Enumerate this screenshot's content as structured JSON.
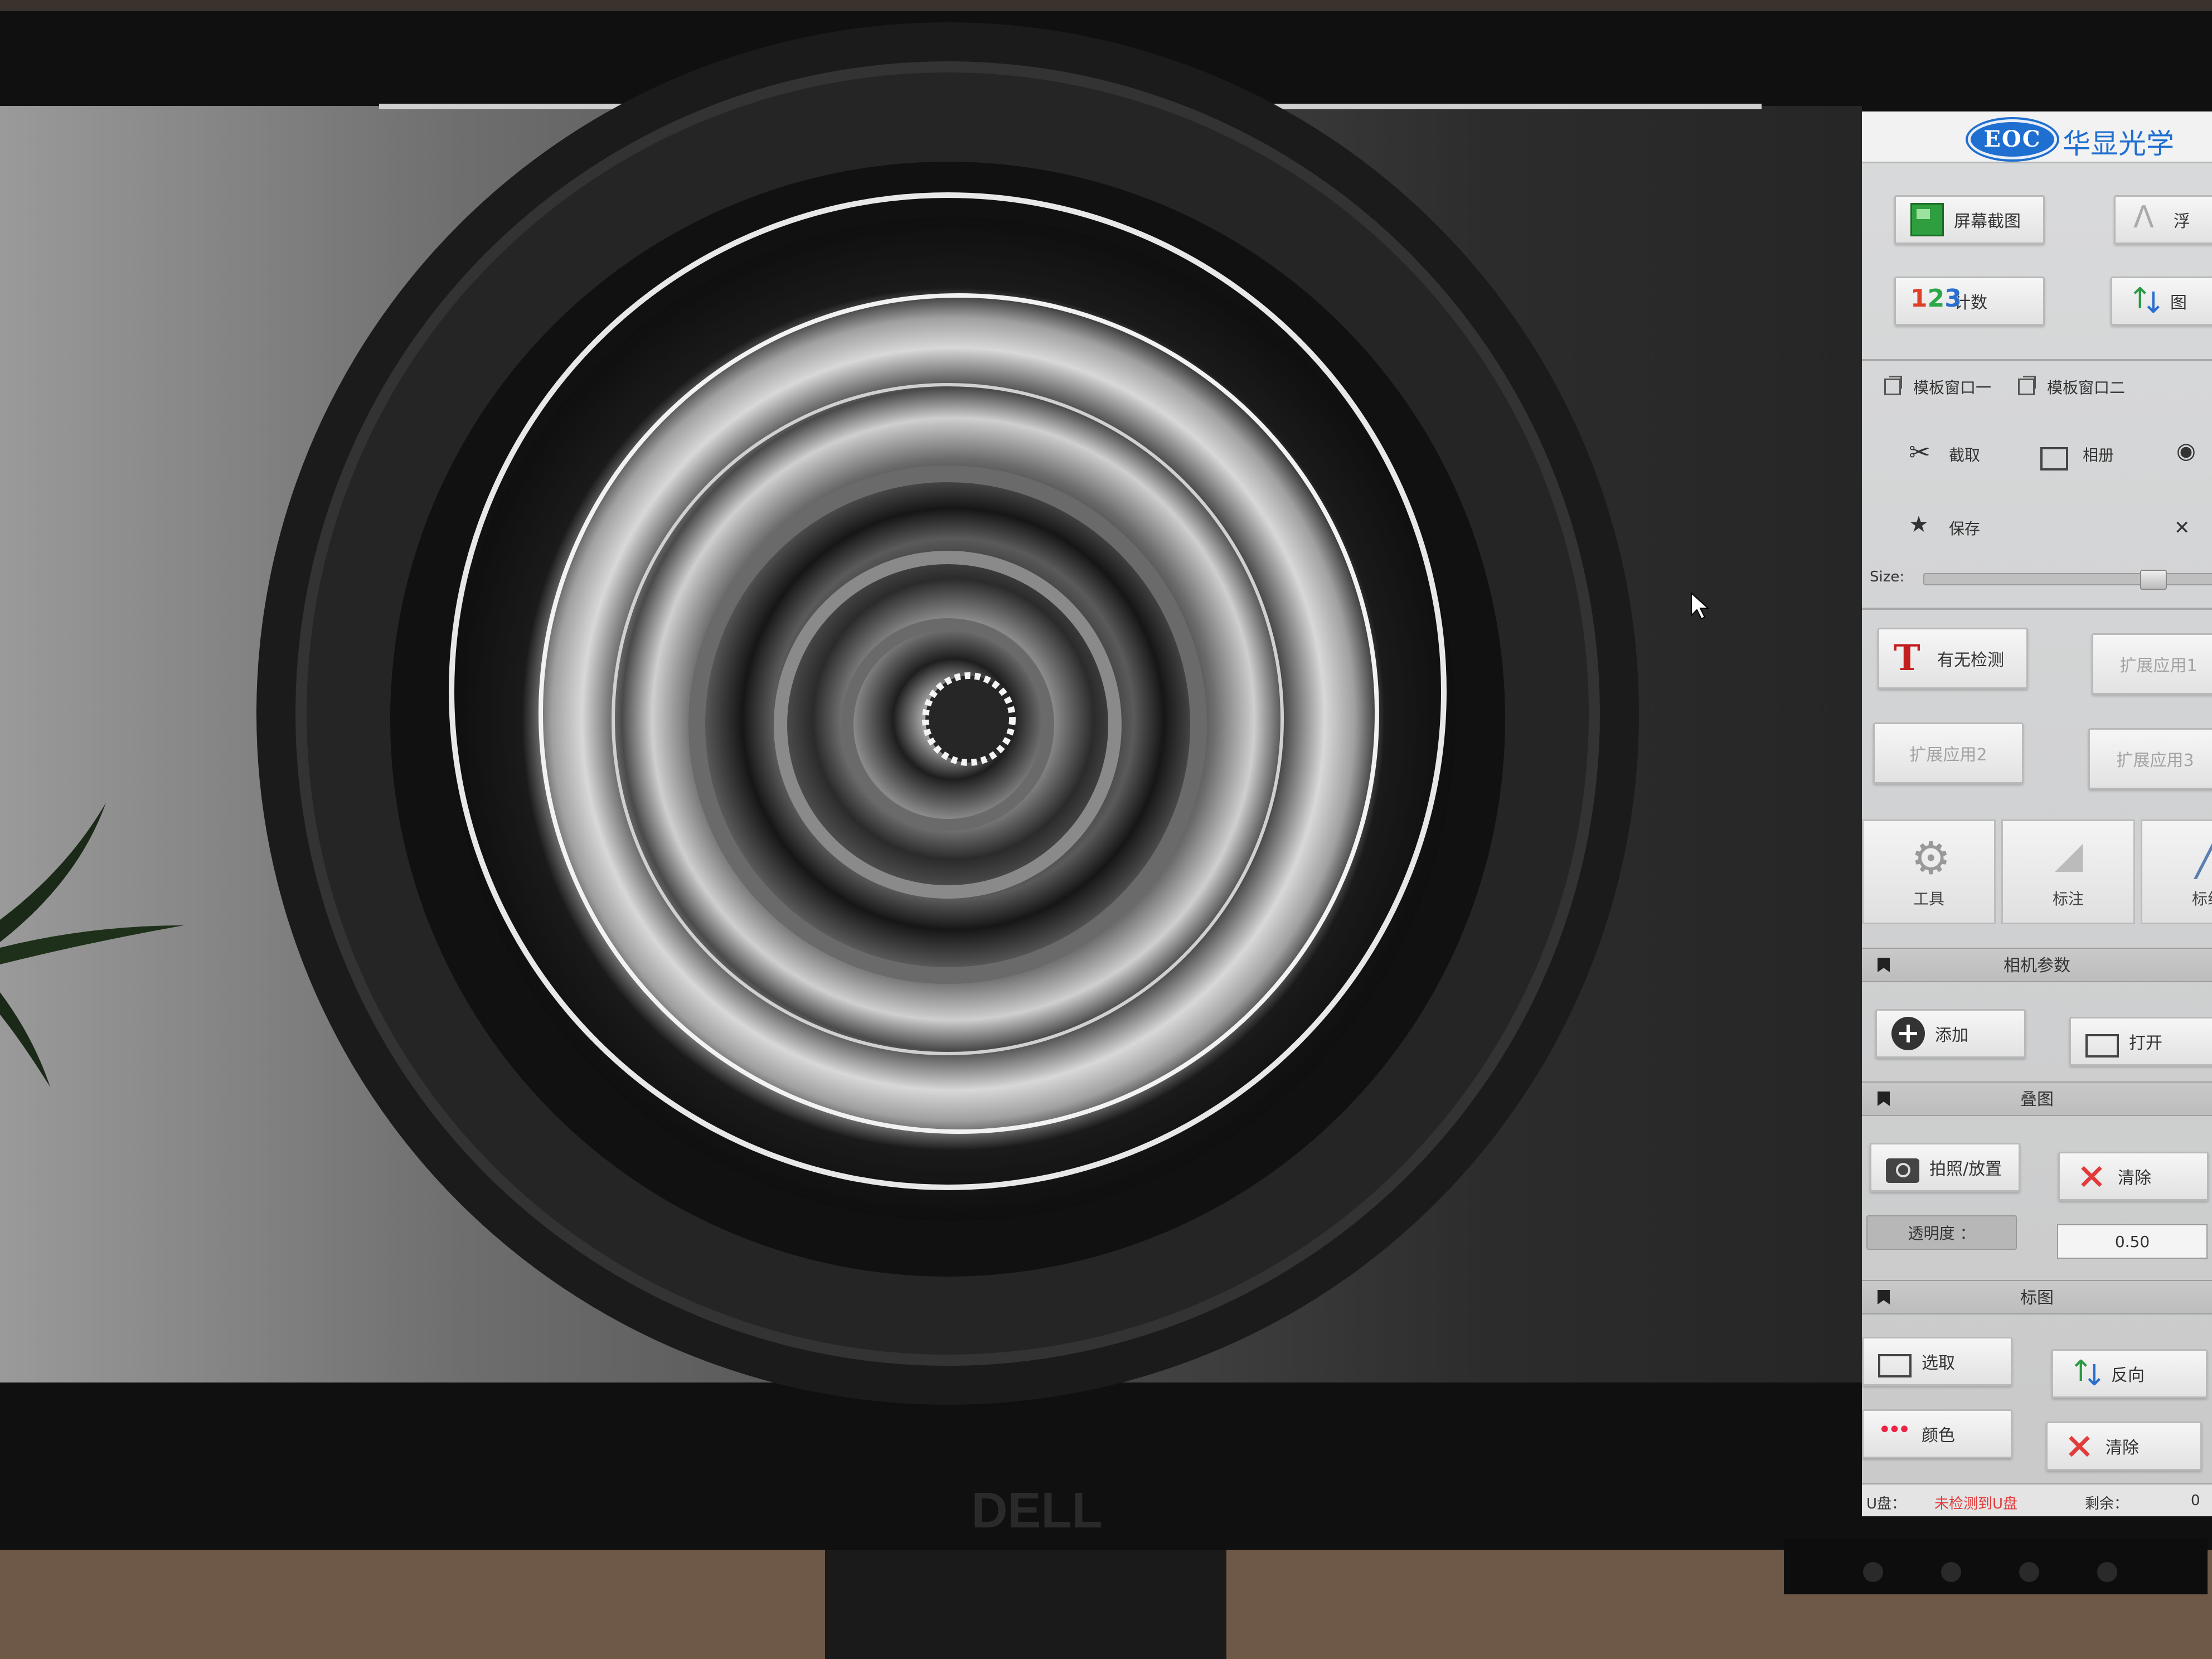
{
  "branding": {
    "logo": "EOC",
    "name": "华显光学"
  },
  "toolbar_top": [
    {
      "label": "屏幕截图",
      "icon": "screenshot-icon"
    },
    {
      "label": "浮",
      "icon": "peak-icon"
    },
    {
      "label": "计数",
      "icon": "count-icon"
    },
    {
      "label": "图",
      "icon": "flip-icon"
    }
  ],
  "template_tabs": [
    "模板窗口一",
    "模板窗口二"
  ],
  "template_actions": {
    "capture": "截取",
    "album": "相册",
    "save": "保存"
  },
  "size_slider": {
    "label": "Size:",
    "value": 0.78
  },
  "detection": {
    "presence": "有无检测",
    "ext1": "扩展应用1",
    "ext2": "扩展应用2",
    "ext3": "扩展应用3"
  },
  "tools": {
    "tool": "工具",
    "annotate": "标注",
    "mark_line": "标线"
  },
  "camera_params": {
    "title": "相机参数",
    "add": "添加",
    "open": "打开"
  },
  "overlay": {
    "title": "叠图",
    "capture_place": "拍照/放置",
    "clear": "清除",
    "opacity_label": "透明度 ：",
    "opacity_value": "0.50"
  },
  "mark_image": {
    "title": "标图",
    "select": "选取",
    "reverse": "反向",
    "color": "颜色",
    "clear": "清除"
  },
  "status": {
    "usb_label": "U盘：",
    "usb_value": "未检测到U盘",
    "remain_label": "剩余：",
    "remain_value": "0"
  },
  "monitor_brand": "DELL",
  "colors": {
    "accent_blue": "#1f6fd0",
    "warn_red": "#e23b3b",
    "panel_bg": "#d4d5d6"
  }
}
